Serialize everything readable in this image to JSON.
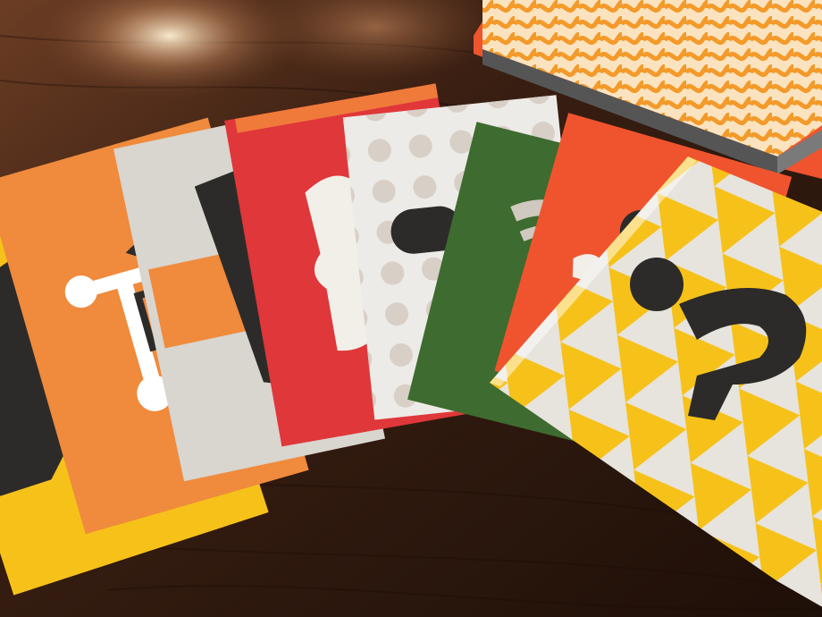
{
  "scene": {
    "subject": "fanned-typography-cards-on-wooden-table",
    "card_count": 8,
    "palette": {
      "wood_dark": "#2a160c",
      "wood_mid": "#4a2818",
      "wood_light": "#7a4a2e",
      "charcoal": "#2d2b29",
      "cream": "#f2efe9",
      "grey_card": "#d9d5cf",
      "yellow": "#f6c21a",
      "orange": "#f08a3c",
      "orange_red": "#f0542e",
      "red": "#e0373a",
      "green": "#3e6b2f",
      "box_orange": "#f4a540"
    }
  }
}
